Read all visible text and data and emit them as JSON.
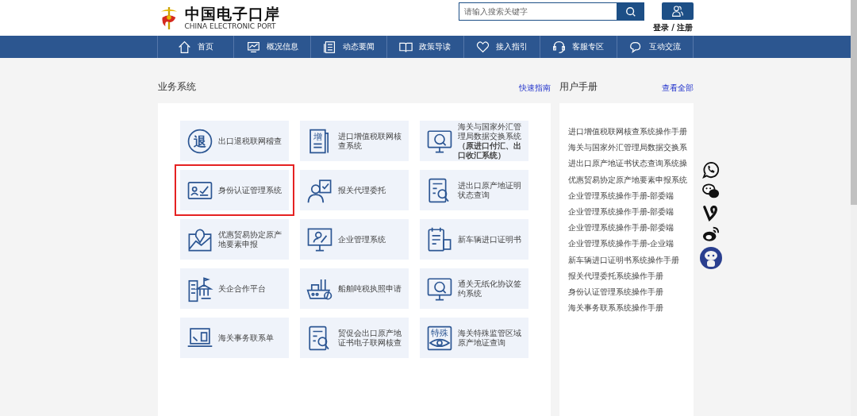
{
  "logo": {
    "title": "中国电子口岸",
    "subtitle": "CHINA ELECTRONIC PORT"
  },
  "search": {
    "placeholder": "请输入搜索关键字"
  },
  "login": {
    "label": "登录 / 注册"
  },
  "nav": [
    {
      "label": "首页"
    },
    {
      "label": "概况信息"
    },
    {
      "label": "动态要闻"
    },
    {
      "label": "政策导读"
    },
    {
      "label": "接入指引"
    },
    {
      "label": "客服专区"
    },
    {
      "label": "互动交流"
    }
  ],
  "business": {
    "title": "业务系统",
    "link": "快速指南",
    "tiles": [
      {
        "label": "出口退税联网稽查",
        "icon_text": "退",
        "highlighted": false
      },
      {
        "label": "进口增值税联网核查系统",
        "icon_text": "增",
        "highlighted": false
      },
      {
        "label": "海关与国家外汇管理局数据交换系统**（原进口付汇、出口收汇系统）**",
        "highlighted": false
      },
      {
        "label": "身份认证管理系统",
        "highlighted": true
      },
      {
        "label": "报关代理委托",
        "highlighted": false
      },
      {
        "label": "进出口原产地证明状态查询",
        "highlighted": false
      },
      {
        "label": "优惠贸易协定原产地要素申报",
        "highlighted": false
      },
      {
        "label": "企业管理系统",
        "highlighted": false
      },
      {
        "label": "新车辆进口证明书",
        "highlighted": false
      },
      {
        "label": "关企合作平台",
        "highlighted": false
      },
      {
        "label": "船舶吨税执照申请",
        "highlighted": false
      },
      {
        "label": "通关无纸化协议签约系统",
        "highlighted": false
      },
      {
        "label": "海关事务联系单",
        "highlighted": false
      },
      {
        "label": "贸促会出口原产地证书电子联网核查",
        "highlighted": false
      },
      {
        "label": "海关特殊监管区域原产地证查询",
        "icon_text": "特殊",
        "highlighted": false
      }
    ]
  },
  "manual": {
    "title": "用户手册",
    "link": "查看全部",
    "items": [
      "进口增值税联网核查系统操作手册",
      "海关与国家外汇管理局数据交换系",
      "进出口原产地证书状态查询系统操",
      "优惠贸易协定原产地要素申报系统",
      "企业管理系统操作手册-部委端",
      "企业管理系统操作手册-部委端",
      "企业管理系统操作手册-部委端",
      "企业管理系统操作手册-企业端",
      "新车辆进口证明书系统操作手册",
      "报关代理委托系统操作手册",
      "身份认证管理系统操作手册",
      "海关事务联系系统操作手册"
    ]
  }
}
